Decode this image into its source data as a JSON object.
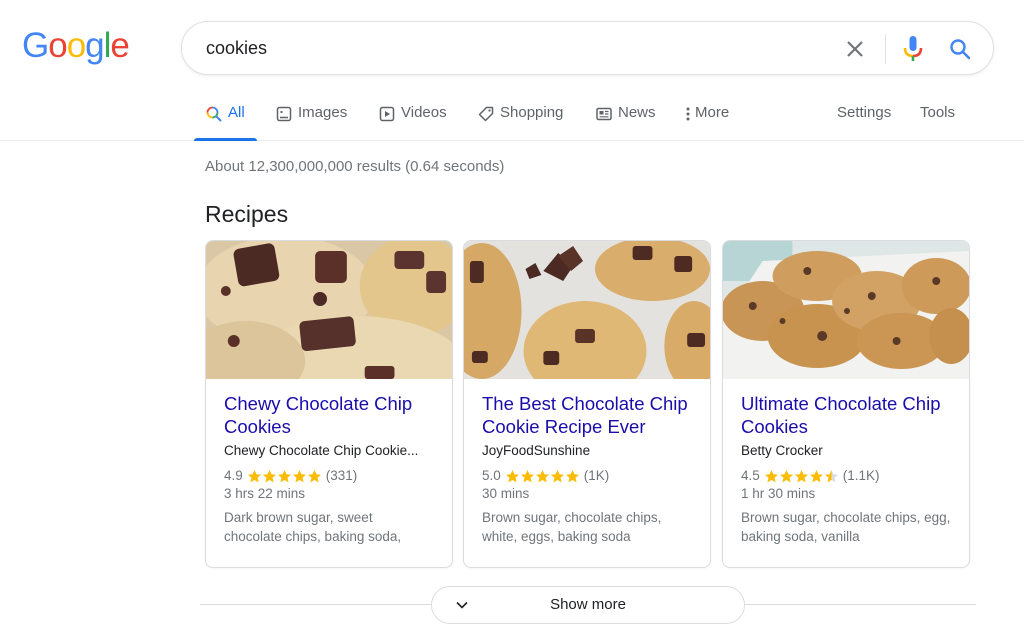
{
  "logo": {
    "letters": [
      {
        "char": "G",
        "color": "#4285f4"
      },
      {
        "char": "o",
        "color": "#ea4335"
      },
      {
        "char": "o",
        "color": "#fbbc05"
      },
      {
        "char": "g",
        "color": "#4285f4"
      },
      {
        "char": "l",
        "color": "#34a853"
      },
      {
        "char": "e",
        "color": "#ea4335"
      }
    ]
  },
  "search": {
    "query": "cookies",
    "clear_icon": "close-icon",
    "voice_icon": "microphone-icon",
    "search_icon": "search-icon"
  },
  "tabs": [
    {
      "label": "All",
      "icon": "search-icon",
      "active": true
    },
    {
      "label": "Images",
      "icon": "image-icon",
      "active": false
    },
    {
      "label": "Videos",
      "icon": "video-icon",
      "active": false
    },
    {
      "label": "Shopping",
      "icon": "tag-icon",
      "active": false
    },
    {
      "label": "News",
      "icon": "news-icon",
      "active": false
    },
    {
      "label": "More",
      "icon": "more-vertical-icon",
      "active": false
    }
  ],
  "tools": {
    "settings_label": "Settings",
    "tools_label": "Tools"
  },
  "results": {
    "stats": "About 12,300,000,000 results (0.64 seconds)",
    "section_title": "Recipes",
    "recipes": [
      {
        "title": "Chewy Chocolate Chip Cookies",
        "source": "Chewy Chocolate Chip Cookie...",
        "rating": "4.9",
        "rating_value": 4.9,
        "reviews": "(331)",
        "time": "3 hrs 22 mins",
        "ingredients": "Dark brown sugar, sweet chocolate chips, baking soda,"
      },
      {
        "title": "The Best Chocolate Chip Cookie Recipe Ever",
        "source": "JoyFoodSunshine",
        "rating": "5.0",
        "rating_value": 5.0,
        "reviews": "(1K)",
        "time": "30 mins",
        "ingredients": "Brown sugar, chocolate chips, white, eggs, baking soda"
      },
      {
        "title": "Ultimate Chocolate Chip Cookies",
        "source": "Betty Crocker",
        "rating": "4.5",
        "rating_value": 4.5,
        "reviews": "(1.1K)",
        "time": "1 hr 30 mins",
        "ingredients": "Brown sugar, chocolate chips, egg, baking soda, vanilla"
      }
    ],
    "show_more_label": "Show more"
  },
  "colors": {
    "link": "#1a0dab",
    "accent": "#1a73e8",
    "star": "#fbbc04",
    "muted": "#70757a"
  }
}
